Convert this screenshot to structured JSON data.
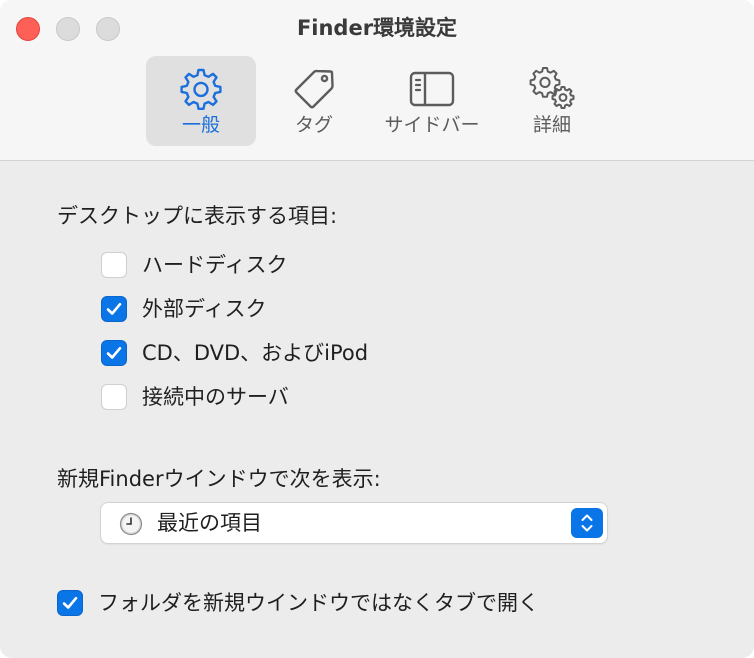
{
  "window": {
    "title": "Finder環境設定"
  },
  "tabs": [
    {
      "label": "一般",
      "icon": "gear-icon",
      "active": true
    },
    {
      "label": "タグ",
      "icon": "tag-icon",
      "active": false
    },
    {
      "label": "サイドバー",
      "icon": "sidebar-icon",
      "active": false
    },
    {
      "label": "詳細",
      "icon": "gears-icon",
      "active": false
    }
  ],
  "desktop_section": {
    "label": "デスクトップに表示する項目:",
    "items": [
      {
        "label": "ハードディスク",
        "checked": false
      },
      {
        "label": "外部ディスク",
        "checked": true
      },
      {
        "label": "CD、DVD、およびiPod",
        "checked": true
      },
      {
        "label": "接続中のサーバ",
        "checked": false
      }
    ]
  },
  "new_window_section": {
    "label": "新規Finderウインドウで次を表示:",
    "selected": "最近の項目",
    "selected_icon": "clock-icon"
  },
  "folder_tabs_option": {
    "label": "フォルダを新規ウインドウではなくタブで開く",
    "checked": true
  },
  "colors": {
    "accent": "#0a75e6",
    "active_tab_label": "#1b6fdc",
    "close_button": "#fe5f57"
  }
}
